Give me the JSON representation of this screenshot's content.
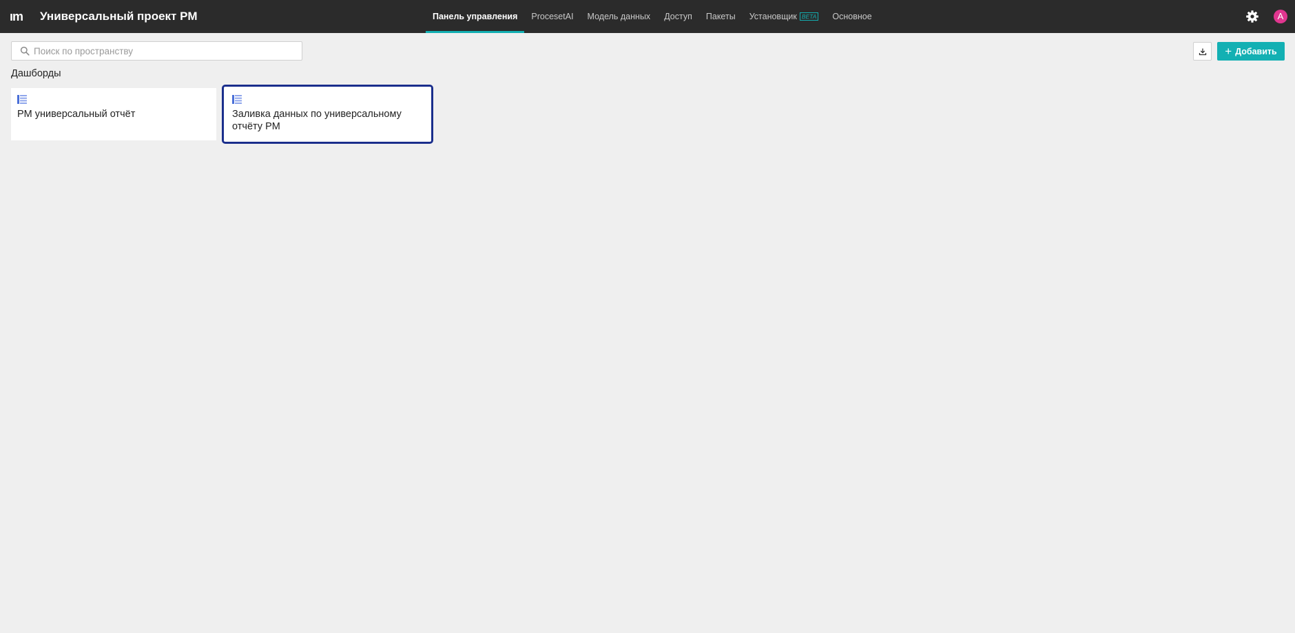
{
  "header": {
    "logo_text": "ım",
    "title": "Универсальный проект PM",
    "avatar_initial": "A",
    "tabs": [
      {
        "label": "Панель управления",
        "active": true
      },
      {
        "label": "ProcesetAI",
        "active": false
      },
      {
        "label": "Модель данных",
        "active": false
      },
      {
        "label": "Доступ",
        "active": false
      },
      {
        "label": "Пакеты",
        "active": false
      },
      {
        "label": "Установщик",
        "active": false,
        "badge": "BETA"
      },
      {
        "label": "Основное",
        "active": false
      }
    ]
  },
  "toolbar": {
    "search_placeholder": "Поиск по пространству",
    "search_value": "",
    "add_label": "Добавить"
  },
  "section": {
    "title": "Дашборды"
  },
  "cards": [
    {
      "label": "PM универсальный отчёт",
      "icon": "dashboard-icon",
      "selected": false
    },
    {
      "label": "Заливка данных по универсальному отчёту PM",
      "icon": "dashboard-icon",
      "selected": true
    }
  ],
  "colors": {
    "topbar": "#2b2b2b",
    "accent": "#13b0b3",
    "selected_border": "#1a2e8c",
    "avatar": "#e0368f",
    "background": "#efefef"
  }
}
